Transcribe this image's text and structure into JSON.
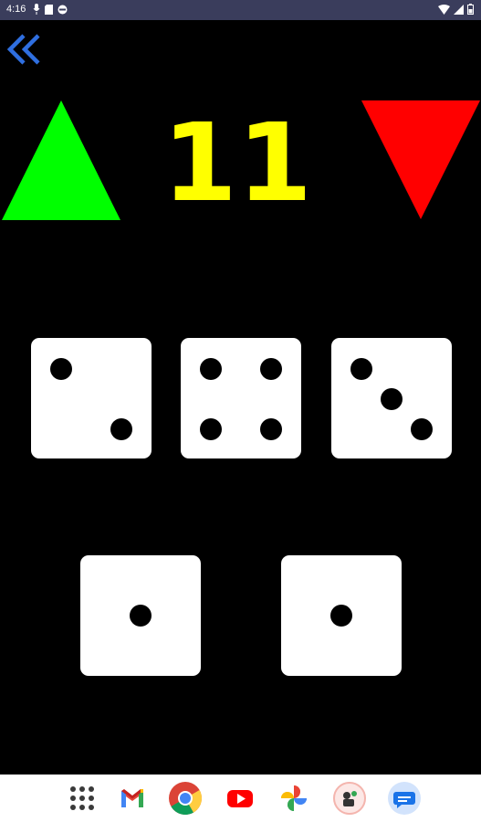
{
  "status_bar": {
    "time": "4:16",
    "icons": [
      "mic-icon",
      "sd-card-icon",
      "data-saver-icon",
      "wifi-icon",
      "signal-icon",
      "battery-icon"
    ]
  },
  "controls": {
    "back_icon": "double-chevron-left-icon",
    "increase_icon": "up-triangle-icon",
    "decrease_icon": "down-triangle-icon"
  },
  "counter": {
    "value": "11",
    "color": "#ffff00"
  },
  "colors": {
    "background": "#000000",
    "increase": "#00ff00",
    "decrease": "#ff0000",
    "back": "#2f6fe0",
    "die_face": "#ffffff",
    "pip": "#000000"
  },
  "dice": [
    {
      "face": 2
    },
    {
      "face": 4
    },
    {
      "face": 3
    },
    {
      "face": 1
    },
    {
      "face": 1
    }
  ],
  "dock": {
    "apps": [
      "apps-grid-icon",
      "gmail-icon",
      "chrome-icon",
      "youtube-icon",
      "photos-icon",
      "camera-app-icon",
      "messages-icon"
    ]
  }
}
